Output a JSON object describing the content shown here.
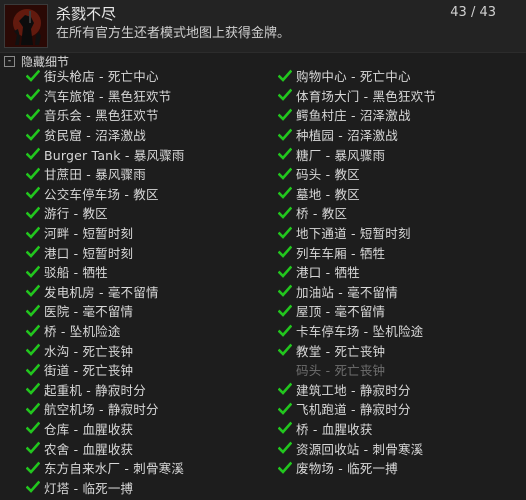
{
  "achievement": {
    "title": "杀戮不尽",
    "description": "在所有官方生还者模式地图上获得金牌。",
    "progress": "43 / 43",
    "icon": "achievement-icon"
  },
  "details_toggle": {
    "symbol": "-",
    "label": "隐藏细节"
  },
  "colors": {
    "check": "#22c61e",
    "text": "#d8d8d8",
    "incomplete_text": "#6e6e6e",
    "background": "#1d1d1d"
  },
  "left_items": [
    {
      "label": "街头枪店 - 死亡中心",
      "done": true
    },
    {
      "label": "汽车旅馆 - 黑色狂欢节",
      "done": true
    },
    {
      "label": "音乐会 - 黑色狂欢节",
      "done": true
    },
    {
      "label": "贫民窟 - 沼泽激战",
      "done": true
    },
    {
      "label": "Burger Tank - 暴风骤雨",
      "done": true
    },
    {
      "label": "甘蔗田 - 暴风骤雨",
      "done": true
    },
    {
      "label": "公交车停车场 - 教区",
      "done": true
    },
    {
      "label": "游行 - 教区",
      "done": true
    },
    {
      "label": "河畔 - 短暂时刻",
      "done": true
    },
    {
      "label": "港口 - 短暂时刻",
      "done": true
    },
    {
      "label": "驳船 - 牺牲",
      "done": true
    },
    {
      "label": "发电机房 - 毫不留情",
      "done": true
    },
    {
      "label": "医院 - 毫不留情",
      "done": true
    },
    {
      "label": "桥 - 坠机险途",
      "done": true
    },
    {
      "label": "水沟 - 死亡丧钟",
      "done": true
    },
    {
      "label": "街道 - 死亡丧钟",
      "done": true
    },
    {
      "label": "起重机 - 静寂时分",
      "done": true
    },
    {
      "label": "航空机场 - 静寂时分",
      "done": true
    },
    {
      "label": "仓库 - 血腥收获",
      "done": true
    },
    {
      "label": "农舍 - 血腥收获",
      "done": true
    },
    {
      "label": "东方自来水厂 - 刺骨寒溪",
      "done": true
    },
    {
      "label": "灯塔 - 临死一搏",
      "done": true
    }
  ],
  "right_items": [
    {
      "label": "购物中心 - 死亡中心",
      "done": true
    },
    {
      "label": "体育场大门 - 黑色狂欢节",
      "done": true
    },
    {
      "label": "鳄鱼村庄 - 沼泽激战",
      "done": true
    },
    {
      "label": "种植园 - 沼泽激战",
      "done": true
    },
    {
      "label": "糖厂 - 暴风骤雨",
      "done": true
    },
    {
      "label": "码头 - 教区",
      "done": true
    },
    {
      "label": "墓地 - 教区",
      "done": true
    },
    {
      "label": "桥 - 教区",
      "done": true
    },
    {
      "label": "地下通道 - 短暂时刻",
      "done": true
    },
    {
      "label": "列车车厢 - 牺牲",
      "done": true
    },
    {
      "label": "港口 - 牺牲",
      "done": true
    },
    {
      "label": "加油站 - 毫不留情",
      "done": true
    },
    {
      "label": "屋顶 - 毫不留情",
      "done": true
    },
    {
      "label": "卡车停车场 - 坠机险途",
      "done": true
    },
    {
      "label": "教堂 - 死亡丧钟",
      "done": true
    },
    {
      "label": "码头 - 死亡丧钟",
      "done": false
    },
    {
      "label": "建筑工地 - 静寂时分",
      "done": true
    },
    {
      "label": "飞机跑道 - 静寂时分",
      "done": true
    },
    {
      "label": "桥 - 血腥收获",
      "done": true
    },
    {
      "label": "资源回收站 - 刺骨寒溪",
      "done": true
    },
    {
      "label": "废物场 - 临死一搏",
      "done": true
    }
  ]
}
